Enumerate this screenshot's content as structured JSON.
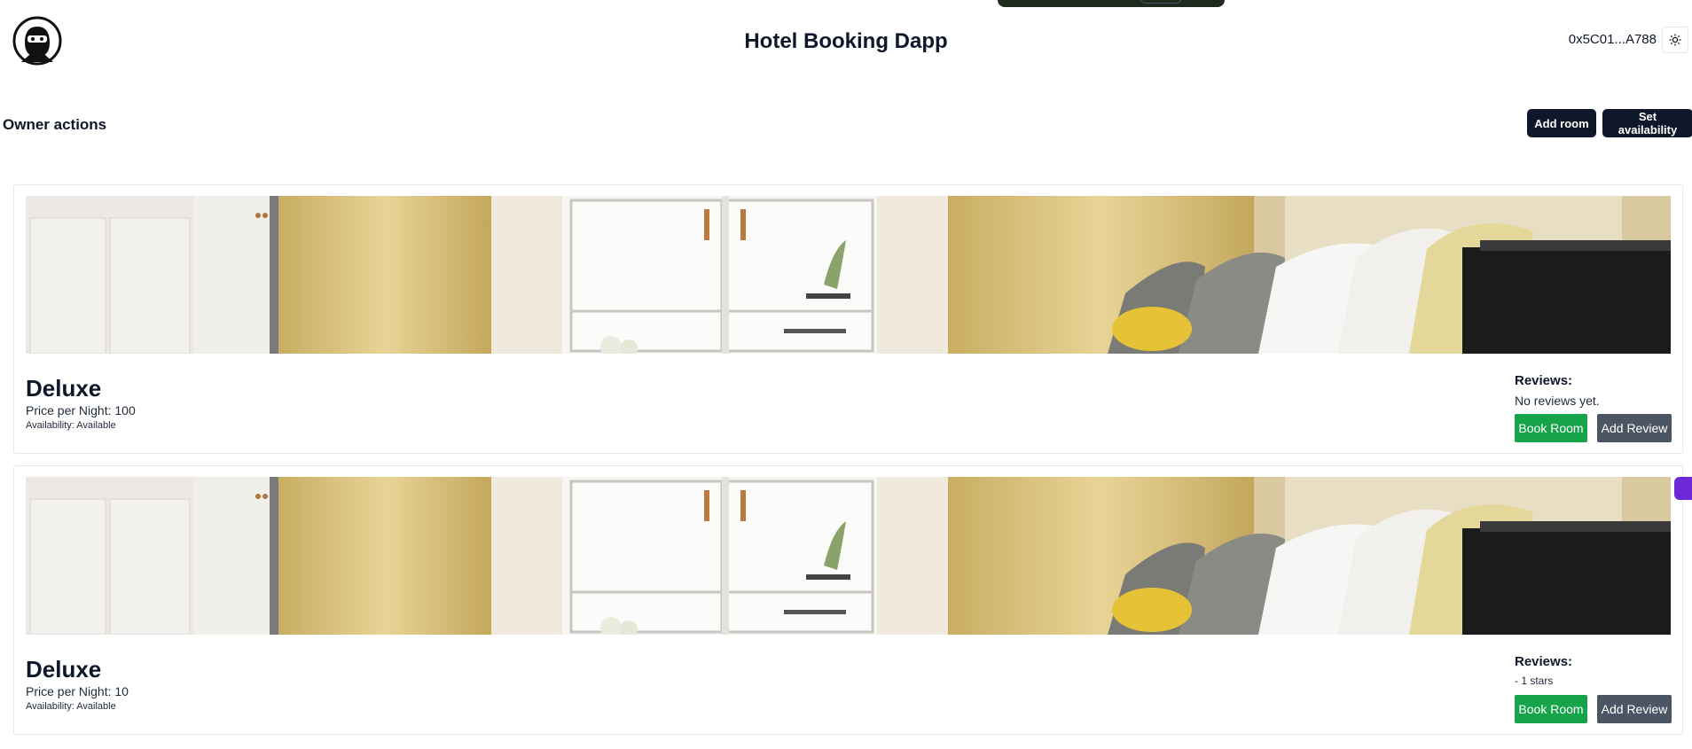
{
  "header": {
    "title": "Hotel Booking Dapp",
    "wallet": "0x5C01...A788",
    "logo_icon": "ninja-logo-icon",
    "theme_icon": "sun-icon"
  },
  "owner": {
    "title": "Owner actions",
    "add_room_label": "Add room",
    "set_availability_label": "Set availability"
  },
  "rooms": [
    {
      "name": "Deluxe",
      "price": "Price per Night: 100",
      "availability": "Availability: Available",
      "reviews_title": "Reviews:",
      "reviews_text": "No reviews yet.",
      "book_label": "Book Room",
      "review_label": "Add Review"
    },
    {
      "name": "Deluxe",
      "price": "Price per Night: 10",
      "availability": "Availability: Available",
      "reviews_title": "Reviews:",
      "reviews_text": "- 1 stars",
      "book_label": "Book Room",
      "review_label": "Add Review"
    }
  ],
  "colors": {
    "primary_dark": "#0f172a",
    "book_green": "#16a34a",
    "review_gray": "#4b5563",
    "side_purple": "#6d28d9"
  }
}
